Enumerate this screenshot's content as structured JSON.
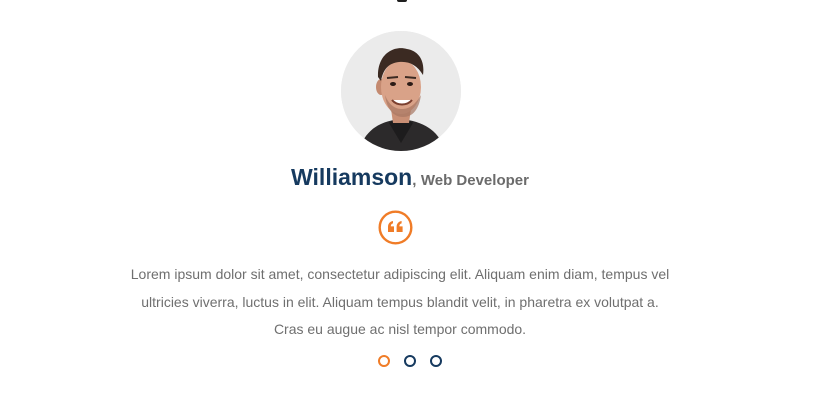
{
  "testimonial": {
    "name": "Williamson",
    "separator": ",",
    "role": "Web Developer",
    "quote_lines": [
      "Lorem ipsum dolor sit amet, consectetur adipiscing elit. Aliquam enim diam, tempus vel",
      "ultricies viverra, luctus in elit. Aliquam tempus blandit velit, in pharetra ex volutpat a.",
      "Cras eu augue ac nisl tempor commodo."
    ],
    "quote_icon": "quote-left-icon"
  },
  "carousel": {
    "slide_count": 3,
    "active_index": 0
  },
  "colors": {
    "accent": "#f07c27",
    "name": "#163a5f",
    "muted_text": "#6f6f6f"
  }
}
